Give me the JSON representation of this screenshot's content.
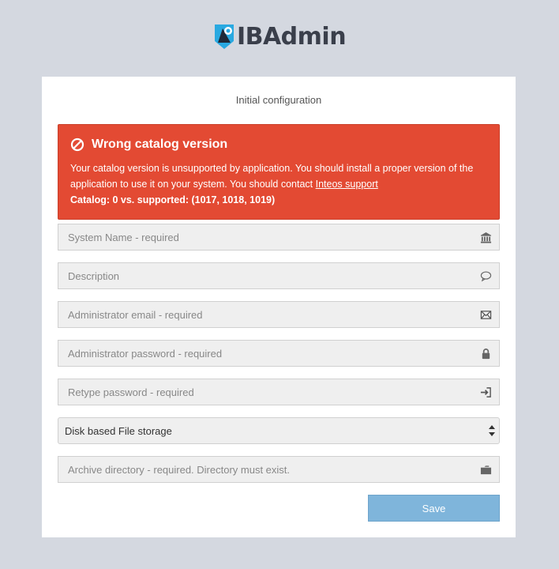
{
  "app": {
    "name": "IBAdmin"
  },
  "panel": {
    "title": "Initial configuration"
  },
  "alert": {
    "title": "Wrong catalog version",
    "message": "Your catalog version is unsupported by application. You should install a proper version of the application to use it on your system. You should contact ",
    "link_text": "Inteos support",
    "detail": "Catalog: 0 vs. supported: (1017, 1018, 1019)",
    "color": "#e34a33"
  },
  "form": {
    "system_name": {
      "placeholder": "System Name - required",
      "value": "",
      "icon": "bank-icon"
    },
    "description": {
      "placeholder": "Description",
      "value": "",
      "icon": "comment-icon"
    },
    "admin_email": {
      "placeholder": "Administrator email - required",
      "value": "",
      "icon": "envelope-icon"
    },
    "admin_password": {
      "placeholder": "Administrator password - required",
      "value": "",
      "icon": "lock-icon"
    },
    "retype_password": {
      "placeholder": "Retype password - required",
      "value": "",
      "icon": "login-icon"
    },
    "storage": {
      "selected": "Disk based File storage"
    },
    "archive_dir": {
      "placeholder": "Archive directory - required. Directory must exist.",
      "value": "",
      "icon": "folder-icon"
    },
    "save_label": "Save",
    "save_color": "#7fb5db"
  }
}
